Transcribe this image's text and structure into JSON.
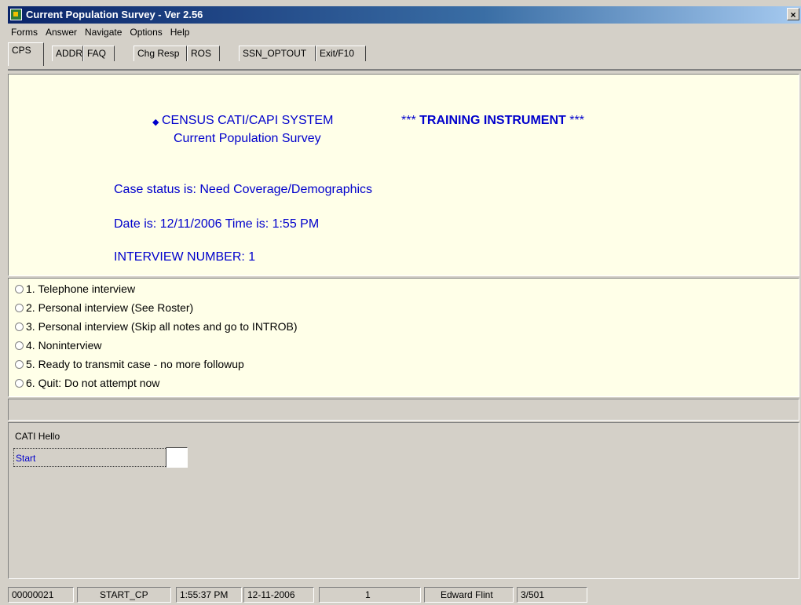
{
  "window": {
    "title": "Current Population Survey - Ver 2.56",
    "close_glyph": "×"
  },
  "menu": [
    "Forms",
    "Answer",
    "Navigate",
    "Options",
    "Help"
  ],
  "tabs": [
    "CPS",
    "ADDR",
    "FAQ",
    "Chg Resp",
    "ROS",
    "SSN_OPTOUT",
    "Exit/F10"
  ],
  "info": {
    "system_line": "CENSUS CATI/CAPI SYSTEM",
    "survey_line": "Current Population Survey",
    "training_prefix": "***",
    "training_text": "TRAINING INSTRUMENT",
    "training_suffix": "***",
    "case_status": "Case status is: Need Coverage/Demographics",
    "date_time": "Date is: 12/11/2006 Time is: 1:55 PM",
    "interview_number": "INTERVIEW NUMBER: 1"
  },
  "answers": [
    "1. Telephone interview",
    "2. Personal interview (See Roster)",
    "3. Personal interview (Skip all notes and go to INTROB)",
    "4. Noninterview",
    "5. Ready to transmit case - no more followup",
    "6. Quit: Do not attempt now"
  ],
  "field": {
    "title": "CATI Hello",
    "label": "Start",
    "value": ""
  },
  "status": [
    "00000021",
    "START_CP",
    "1:55:37 PM",
    "12-11-2006",
    "1",
    "Edward Flint",
    "3/501"
  ],
  "colors": {
    "panel_bg": "#ffffe8",
    "text_blue": "#0000cc",
    "chrome": "#d4d0c8",
    "title_bar": "#0a246a"
  }
}
